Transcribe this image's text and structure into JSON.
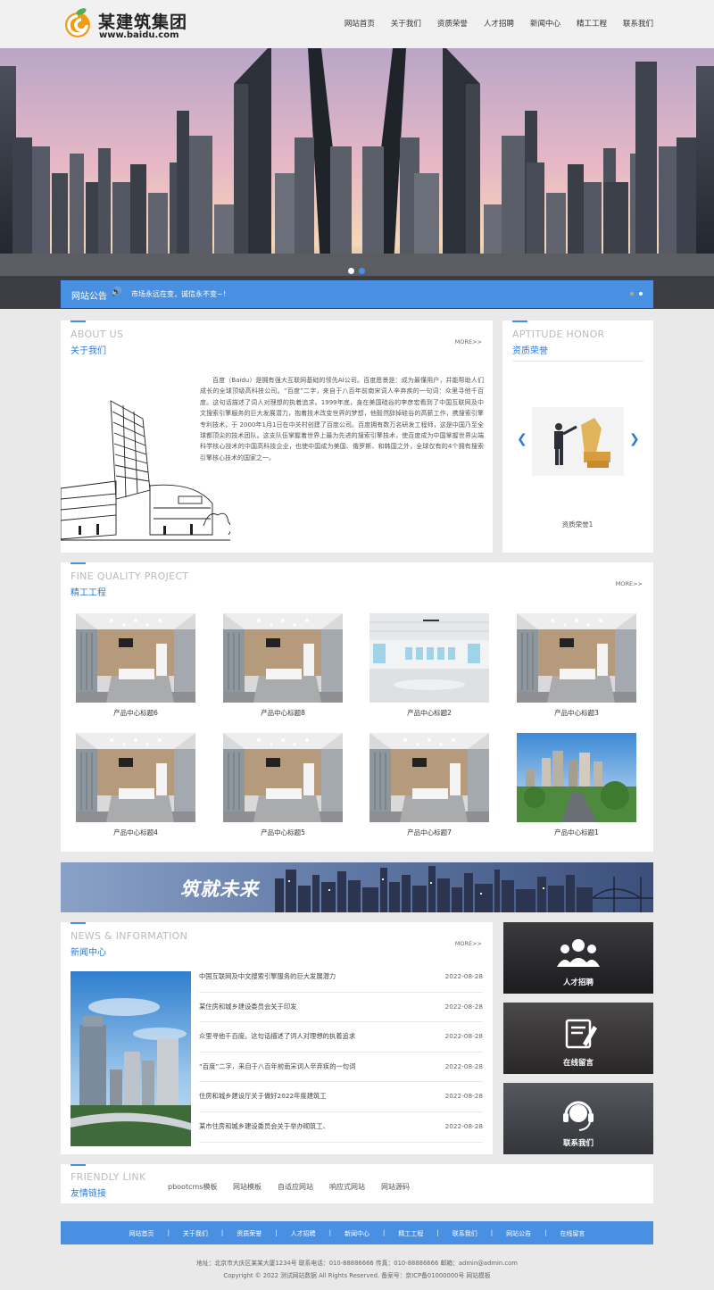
{
  "brand": {
    "name": "某建筑集团",
    "url": "www.baidu.com"
  },
  "nav": [
    "网站首页",
    "关于我们",
    "资质荣誉",
    "人才招聘",
    "新闻中心",
    "精工工程",
    "联系我们"
  ],
  "notice": {
    "title": "网站公告",
    "text": "市场永远在变，诚信永不变~！"
  },
  "about": {
    "en": "ABOUT US",
    "cn": "关于我们",
    "more": "MORE>>",
    "text": "百度（Baidu）是拥有强大互联网基础的领先AI公司。百度愿景是：成为最懂用户，并能帮助人们成长的全球顶级高科技公司。“百度”二字，来自于八百年前南宋词人辛弃疾的一句词：众里寻他千百度。这句话描述了词人对理想的执着追求。1999年底，身在美国硅谷的李彦宏看到了中国互联网及中文搜索引擎服务的巨大发展潜力，抱着技术改变世界的梦想，他毅然辞掉硅谷的高薪工作，携搜索引擎专利技术，于 2000年1月1日在中关村创建了百度公司。百度拥有数万名研发工程师，这是中国乃至全球都顶尖的技术团队。这支队伍掌握着世界上最为先进的搜索引擎技术，使百度成为中国掌握世界尖端科学核心技术的中国高科技企业，也使中国成为美国、俄罗斯、和韩国之外，全球仅有的4个拥有搜索引擎核心技术的国家之一。"
  },
  "honor": {
    "en": "APTITUDE HONOR",
    "cn": "资质荣誉",
    "caption": "资质荣誉1"
  },
  "projects": {
    "en": "FINE QUALITY PROJECT",
    "cn": "精工工程",
    "more": "MORE>>",
    "items": [
      {
        "title": "产品中心标题6",
        "kind": "room"
      },
      {
        "title": "产品中心标题8",
        "kind": "room"
      },
      {
        "title": "产品中心标题2",
        "kind": "hall"
      },
      {
        "title": "产品中心标题3",
        "kind": "room"
      },
      {
        "title": "产品中心标题4",
        "kind": "room"
      },
      {
        "title": "产品中心标题5",
        "kind": "room"
      },
      {
        "title": "产品中心标题7",
        "kind": "room"
      },
      {
        "title": "产品中心标题1",
        "kind": "city"
      }
    ]
  },
  "slogan": "筑就未来",
  "news": {
    "en": "NEWS & INFORMATION",
    "cn": "新闻中心",
    "more": "MORE>>",
    "items": [
      {
        "title": "中国互联网及中文搜索引擎服务的巨大发展潜力",
        "date": "2022-08-28"
      },
      {
        "title": "某住房和城乡建设委员会关于印发",
        "date": "2022-08-28"
      },
      {
        "title": "众里寻他千百度。这句话描述了词人对理想的执着追求",
        "date": "2022-08-28"
      },
      {
        "title": "“百度”二字，来自于八百年前南宋词人辛弃疾的一句词",
        "date": "2022-08-28"
      },
      {
        "title": "住房和城乡建设厅关于做好2022年度建筑工",
        "date": "2022-08-28"
      },
      {
        "title": "某市住房和城乡建设委员会关于举办砌筑工、",
        "date": "2022-08-28"
      }
    ]
  },
  "tiles": [
    {
      "label": "人才招聘",
      "icon": "people-icon"
    },
    {
      "label": "在线留言",
      "icon": "message-icon"
    },
    {
      "label": "联系我们",
      "icon": "headset-icon"
    }
  ],
  "links": {
    "en": "FRIENDLY LINK",
    "cn": "友情链接",
    "items": [
      "pbootcms模板",
      "网站模板",
      "自适应网站",
      "响应式网站",
      "网站源码"
    ]
  },
  "footer": {
    "nav": [
      "网站首页",
      "关于我们",
      "资质荣誉",
      "人才招聘",
      "新闻中心",
      "精工工程",
      "联系我们",
      "网站公告",
      "在线留言"
    ],
    "line1": "地址：北京市大庆区某某大厦1234号  联系电话：010-88886666  传真：010-88886666  邮箱：admin@admin.com",
    "line2": "Copyright © 2022 测试网站数据 All Rights Reserved.    备案号：京ICP备01000000号 网站模板"
  },
  "colors": {
    "accent": "#4a90e2",
    "link": "#2b7bd6",
    "background": "#e9e9e9"
  }
}
